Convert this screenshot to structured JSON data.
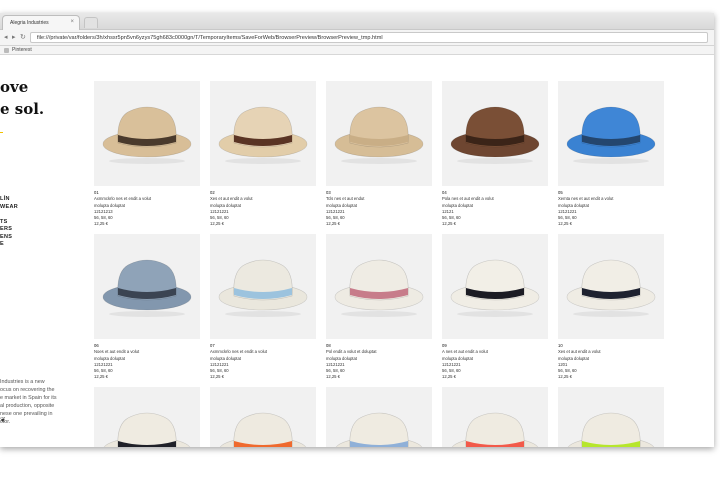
{
  "browser": {
    "tab_title": "Alegria Industries",
    "tab_close": "×",
    "address": "file:///private/var/folders/3h/xhssr5pn5vn6yzys75gh683c0000gn/T/TemporaryItems/SaveForWeb/BrowserPreview/BrowserPreview_tmp.html",
    "bookmark": "Pinterest",
    "back_icon": "back-arrow-icon",
    "forward_icon": "forward-arrow-icon",
    "reload_icon": "reload-icon"
  },
  "sidebar": {
    "headline_line1": "ove",
    "headline_line2": "e sol.",
    "nav": [
      "LÍN",
      "WEAR",
      "",
      "TS",
      "ERS",
      "ENS",
      "E"
    ],
    "about": "Industries is a new\nocus on recovering the\ne market in Spain for its\nal production, opposite\nnese one prevailing in\nctor.",
    "accent": "#f2c200"
  },
  "products": [
    {
      "num": "01",
      "name": "Axmmckrlo nes et endit a volut",
      "desc": "molupta doluptat",
      "code": "12121213",
      "sizes": "56, 58, 60",
      "price": "12,25 €",
      "crown": "#d9c09a",
      "band": "#4a3a2c",
      "brim": "#d8be97"
    },
    {
      "num": "02",
      "name": "Xes et aut endit a volut",
      "desc": "molupta doluptat",
      "code": "12121221",
      "sizes": "56, 58, 60",
      "price": "12,25 €",
      "crown": "#e6d3b5",
      "band": "#5a3424",
      "brim": "#e2cda9"
    },
    {
      "num": "03",
      "name": "Tcls nes et aut endut",
      "desc": "molupta doluptat",
      "code": "12121221",
      "sizes": "56, 58, 60",
      "price": "12,25 €",
      "crown": "#dcc4a0",
      "band": "#c9ae86",
      "brim": "#d6bd96"
    },
    {
      "num": "04",
      "name": "Pola nes et aut endit a volut",
      "desc": "molupta doluptat",
      "code": "12121",
      "sizes": "56, 58, 60",
      "price": "12,25 €",
      "crown": "#7a4f36",
      "band": "#3b2418",
      "brim": "#6e4631"
    },
    {
      "num": "05",
      "name": "Xemta nes et aut endit a volut",
      "desc": "molupta doluptat",
      "code": "12121221",
      "sizes": "56, 58, 60",
      "price": "12,25 €",
      "crown": "#3f86d6",
      "band": "#24466e",
      "brim": "#3a82d2"
    },
    {
      "num": "06",
      "name": "Noes et aut endit a volut",
      "desc": "molupta doluptat",
      "code": "12121221",
      "sizes": "56, 58, 60",
      "price": "12,25 €",
      "crown": "#8fa3b8",
      "band": "#3b4452",
      "brim": "#8297ae"
    },
    {
      "num": "07",
      "name": "Axmmckrlo nes et endit a volut",
      "desc": "molupta doluptat",
      "code": "12121221",
      "sizes": "56, 58, 60",
      "price": "12,25 €",
      "crown": "#ece9e0",
      "band": "#9cc3de",
      "brim": "#eae7dd"
    },
    {
      "num": "08",
      "name": "Pol endit a volut et doluptat",
      "desc": "molupta doluptat",
      "code": "12121221",
      "sizes": "56, 58, 60",
      "price": "12,25 €",
      "crown": "#efece4",
      "band": "#c77c8a",
      "brim": "#eeebe3"
    },
    {
      "num": "09",
      "name": "A nes et aut endit a volut",
      "desc": "molupta doluptat",
      "code": "12121221",
      "sizes": "56, 58, 60",
      "price": "12,25 €",
      "crown": "#f2efe7",
      "band": "#1c1c24",
      "brim": "#f0ede5"
    },
    {
      "num": "10",
      "name": "Xes et aut endit a volut",
      "desc": "molupta doluptat",
      "code": "1201",
      "sizes": "56, 58, 60",
      "price": "12,25 €",
      "crown": "#f1eee6",
      "band": "#1e2230",
      "brim": "#efece4"
    },
    {
      "num": "",
      "name": "",
      "desc": "",
      "code": "",
      "sizes": "",
      "price": "",
      "crown": "#efebe1",
      "band": "#1f2028",
      "brim": "#ece8de"
    },
    {
      "num": "",
      "name": "",
      "desc": "",
      "code": "",
      "sizes": "",
      "price": "",
      "crown": "#eeeae0",
      "band": "#ef6a2e",
      "brim": "#ebe7dd"
    },
    {
      "num": "",
      "name": "",
      "desc": "",
      "code": "",
      "sizes": "",
      "price": "",
      "crown": "#efebe1",
      "band": "#8fb0d8",
      "brim": "#ece8de"
    },
    {
      "num": "",
      "name": "",
      "desc": "",
      "code": "",
      "sizes": "",
      "price": "",
      "crown": "#efebe1",
      "band": "#f25a4a",
      "brim": "#ece8de"
    },
    {
      "num": "",
      "name": "",
      "desc": "",
      "code": "",
      "sizes": "",
      "price": "",
      "crown": "#efebe1",
      "band": "#b6e62c",
      "brim": "#ece8de"
    }
  ]
}
